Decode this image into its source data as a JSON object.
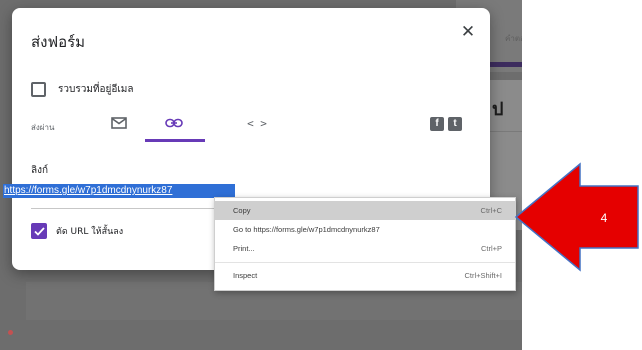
{
  "background": {
    "tab_label": "คำตอ",
    "title_fragment": "ป"
  },
  "dialog": {
    "title": "ส่งฟอร์ม",
    "close_glyph": "✕",
    "collect_email_label": "รวบรวมที่อยู่อีเมล",
    "send_via_label": "ส่งผ่าน",
    "embed_glyph": "< >",
    "facebook_glyph": "f",
    "twitter_glyph": "t",
    "link_heading": "ลิงก์",
    "link_url": "https://forms.gle/w7p1dmcdnynurkz87",
    "shorten_url_label": "ตัด URL ให้สั้นลง",
    "shorten_url_checked": true,
    "active_tab": "link"
  },
  "context_menu": {
    "items": [
      {
        "label": "Copy",
        "shortcut": "Ctrl+C",
        "highlighted": true
      },
      {
        "label": "Go to https://forms.gle/w7p1dmcdnynurkz87",
        "shortcut": ""
      },
      {
        "label": "Print...",
        "shortcut": "Ctrl+P"
      },
      {
        "label": "Inspect",
        "shortcut": "Ctrl+Shift+I"
      }
    ]
  },
  "annotation": {
    "step_number": "4",
    "arrow_color": "#e50000",
    "arrow_outline": "#4472c4"
  },
  "colors": {
    "accent": "#673ab7",
    "selection": "#2f6fd6"
  }
}
